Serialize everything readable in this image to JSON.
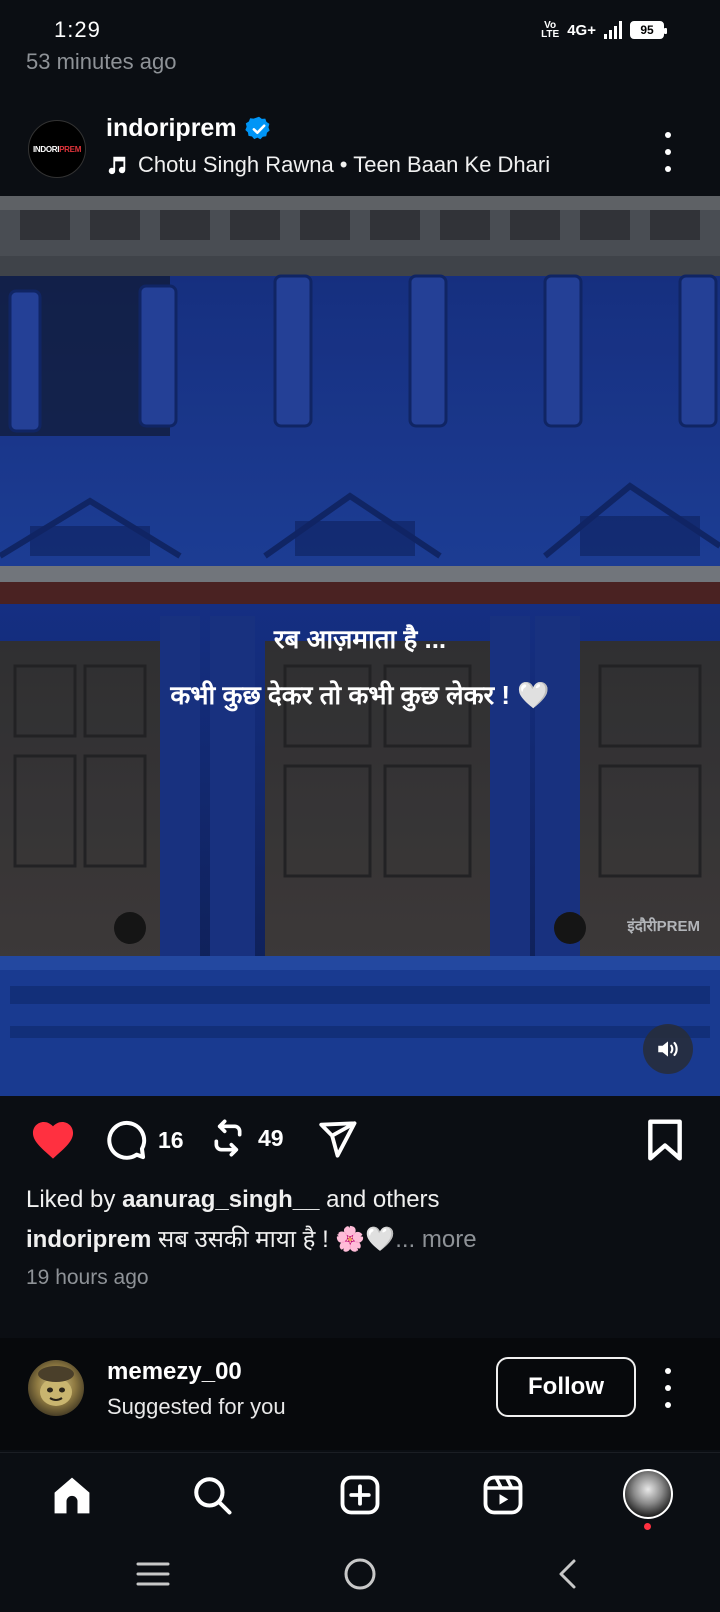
{
  "status_bar": {
    "time": "1:29",
    "volte": "Vo LTE",
    "network": "4G+",
    "battery": "95"
  },
  "previous_post_time": "53 minutes ago",
  "post": {
    "username": "indoriprem",
    "verified": true,
    "avatar_text_white": "INDORI",
    "avatar_text_red": "PREM",
    "music": "Chotu Singh Rawna • Teen Baan Ke Dhari",
    "overlay_line1": "रब आज़माता है ...",
    "overlay_line2": "कभी कुछ देकर तो कभी कुछ लेकर ! 🤍",
    "watermark": "इंदौरीPREM",
    "comments_count": "16",
    "reposts_count": "49",
    "liked": true,
    "liked_by_prefix": "Liked by ",
    "liked_by_user": "aanurag_singh__",
    "liked_by_suffix": " and others",
    "caption_user": "indoriprem",
    "caption_text": " सब उसकी माया है ! 🌸🤍",
    "caption_more": "... more",
    "time": "19 hours ago"
  },
  "suggestion": {
    "username": "memezy_00",
    "subtitle": "Suggested for you",
    "follow_label": "Follow"
  },
  "bottom_nav": [
    "home",
    "search",
    "create",
    "reels",
    "profile"
  ],
  "colors": {
    "background": "#0b0e13",
    "like_red": "#ff3040",
    "verified_blue": "#0095f6",
    "muted_text": "#8e9297"
  }
}
